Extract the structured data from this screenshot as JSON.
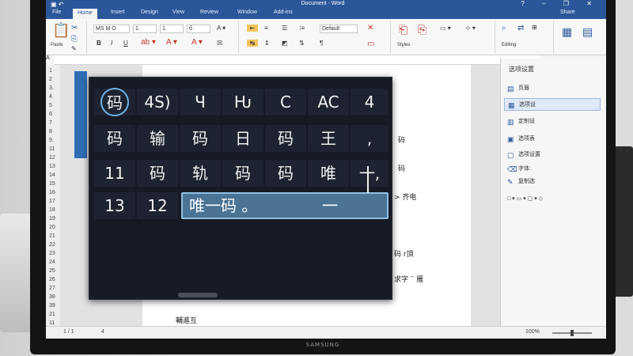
{
  "window": {
    "quick_access": "▣ ↶",
    "title": "Document - Word",
    "buttons": "? – ❐ ✕"
  },
  "tabs": [
    {
      "label": "File"
    },
    {
      "label": "Home"
    },
    {
      "label": "Insert"
    },
    {
      "label": "Design"
    },
    {
      "label": "View"
    },
    {
      "label": "Review"
    },
    {
      "label": "Window"
    },
    {
      "label": "Add-ins"
    }
  ],
  "tabs_right": "Share",
  "ribbon": {
    "paste_label": "Paste",
    "font_name": "MS M O",
    "font_size": "1.",
    "style_value": "Default",
    "bold": "B",
    "italic": "I",
    "underline": "U",
    "right_group_1": "Styles",
    "right_group_2": "Editing"
  },
  "ruler_corner": "A",
  "line_numbers": [
    "1",
    "2",
    "3.",
    "4",
    "5",
    "6",
    "7",
    "8",
    "9.",
    "11",
    "12",
    "13",
    "14",
    "15",
    "16",
    "17",
    "18",
    "19",
    "20",
    "21",
    "22",
    "23",
    "24",
    "25",
    "26",
    "27",
    "38",
    "39",
    "21",
    "11"
  ],
  "page_lines": [
    {
      "text": "码"
    },
    {
      "text": "码"
    },
    {
      "text": "> 齐电"
    },
    {
      "text": "码 r頂"
    },
    {
      "text": "求字 ˘ 雁"
    },
    {
      "text": "輔進互"
    }
  ],
  "ime": {
    "rows": [
      [
        "码",
        "4S)",
        "Ч",
        "Ƕ",
        "C",
        "AC",
        "4"
      ],
      [
        "码",
        "输",
        "码",
        "日",
        "码",
        "王",
        ","
      ],
      [
        "11",
        "码",
        "轨",
        "码",
        "码",
        "唯",
        "一,"
      ],
      [
        "13",
        "12"
      ]
    ],
    "composition": "唯一码 。",
    "composition_tail": "一"
  },
  "pane": {
    "title": "选项设置",
    "items": [
      {
        "icon": "▤",
        "label": "页眉"
      },
      {
        "icon": "▦",
        "label": "选项设"
      },
      {
        "icon": "▥",
        "label": "定制设"
      },
      {
        "icon": "▣",
        "label": "选项表"
      },
      {
        "icon": "▢",
        "label": "选项设置"
      },
      {
        "icon": "⌫",
        "label": "字体:"
      },
      {
        "icon": "✎",
        "label": "复制选"
      }
    ]
  },
  "statusbar": {
    "page": "1 / 1",
    "words": "4",
    "zoom": "100%"
  },
  "bezel_label": "SAMSUNG"
}
